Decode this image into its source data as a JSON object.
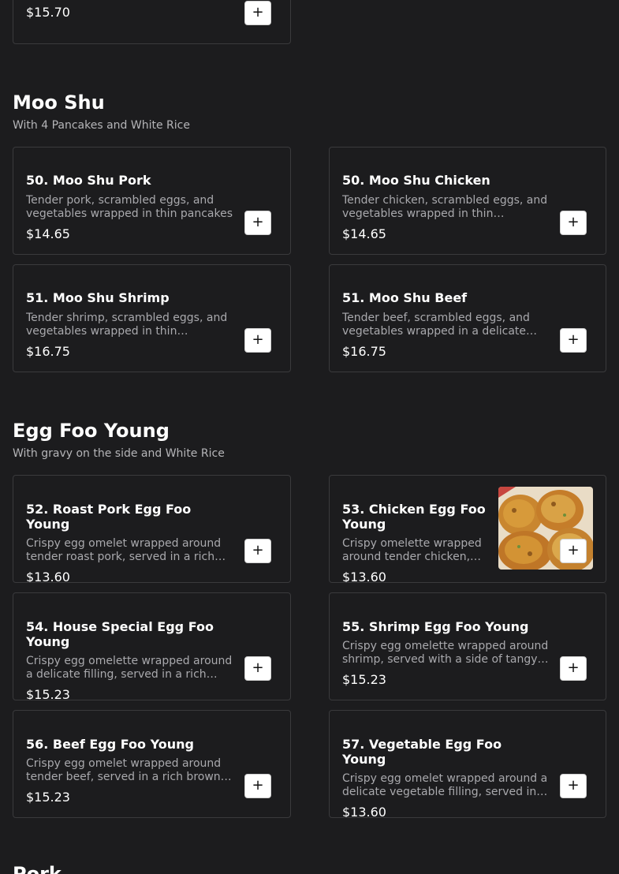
{
  "top_card": {
    "price": "$15.70"
  },
  "sections": {
    "moo_shu": {
      "title": "Moo Shu",
      "subtitle": "With 4 Pancakes and White Rice",
      "items": [
        {
          "name": "50. Moo Shu Pork",
          "desc": "Tender pork, scrambled eggs, and vegetables wrapped in thin pancakes",
          "price": "$14.65"
        },
        {
          "name": "50. Moo Shu Chicken",
          "desc": "Tender chicken, scrambled eggs, and vegetables wrapped in thin…",
          "price": "$14.65"
        },
        {
          "name": "51. Moo Shu Shrimp",
          "desc": "Tender shrimp, scrambled eggs, and vegetables wrapped in thin…",
          "price": "$16.75"
        },
        {
          "name": "51. Moo Shu Beef",
          "desc": "Tender beef, scrambled eggs, and vegetables wrapped in a delicate…",
          "price": "$16.75"
        }
      ]
    },
    "egg_foo_young": {
      "title": "Egg Foo Young",
      "subtitle": "With gravy on the side and White Rice",
      "items": [
        {
          "name": "52. Roast Pork Egg Foo Young",
          "desc": "Crispy egg omelet wrapped around tender roast pork, served in a rich…",
          "price": "$13.60"
        },
        {
          "name": "53. Chicken Egg Foo Young",
          "desc": "Crispy omelette wrapped around tender chicken,…",
          "price": "$13.60"
        },
        {
          "name": "54. House Special Egg Foo Young",
          "desc": "Crispy egg omelette wrapped around a delicate filling, served in a rich…",
          "price": "$15.23"
        },
        {
          "name": "55. Shrimp Egg Foo Young",
          "desc": "Crispy egg omelette wrapped around shrimp, served with a side of tangy…",
          "price": "$15.23"
        },
        {
          "name": "56. Beef Egg Foo Young",
          "desc": "Crispy egg omelet wrapped around tender beef, served in a rich brown…",
          "price": "$15.23"
        },
        {
          "name": "57. Vegetable Egg Foo Young",
          "desc": "Crispy egg omelet wrapped around a delicate vegetable filling, served in…",
          "price": "$13.60"
        }
      ]
    },
    "pork": {
      "title": "Pork"
    }
  },
  "add_button_symbol": "+",
  "icons": {
    "add": "plus-icon"
  }
}
